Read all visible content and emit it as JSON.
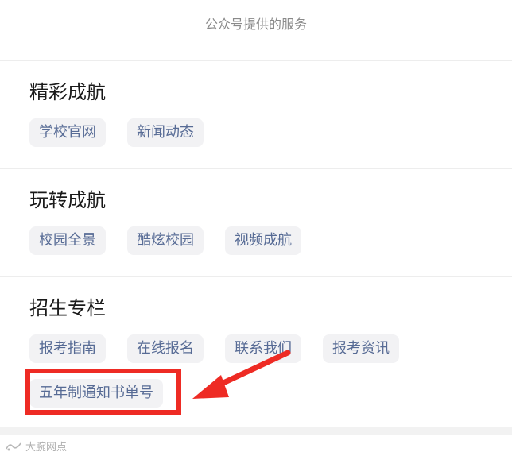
{
  "header": {
    "title": "公众号提供的服务"
  },
  "sections": [
    {
      "title": "精彩成航",
      "items": [
        "学校官网",
        "新闻动态"
      ]
    },
    {
      "title": "玩转成航",
      "items": [
        "校园全景",
        "酷炫校园",
        "视频成航"
      ]
    },
    {
      "title": "招生专栏",
      "items": [
        "报考指南",
        "在线报名",
        "联系我们",
        "报考资讯",
        "五年制通知书单号"
      ]
    }
  ],
  "annotation": {
    "highlight_color": "#ee2b24",
    "highlighted_item": "五年制通知书单号"
  },
  "watermark": {
    "text": "大腕网点"
  },
  "colors": {
    "chip_text": "#576b95",
    "chip_bg": "#f2f2f4",
    "title_text": "#1a1a1a",
    "header_text": "#8a8a8a"
  }
}
